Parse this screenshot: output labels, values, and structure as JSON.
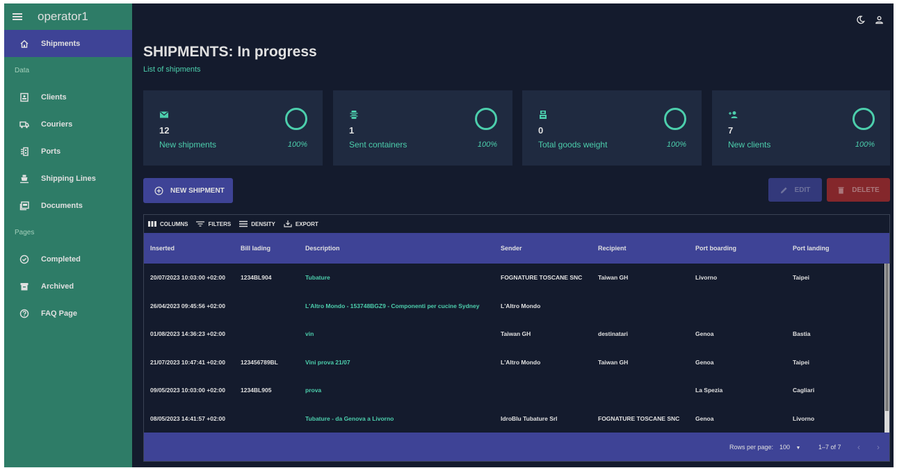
{
  "sidebar": {
    "user": "operator1",
    "items": [
      {
        "label": "Shipments"
      },
      {
        "label": "Clients"
      },
      {
        "label": "Couriers"
      },
      {
        "label": "Ports"
      },
      {
        "label": "Shipping Lines"
      },
      {
        "label": "Documents"
      },
      {
        "label": "Completed"
      },
      {
        "label": "Archived"
      },
      {
        "label": "FAQ Page"
      }
    ],
    "sections": [
      "Data",
      "Pages"
    ]
  },
  "header": {
    "title": "SHIPMENTS: In progress",
    "subtitle": "List of shipments"
  },
  "stats": [
    {
      "value": "12",
      "label": "New shipments",
      "percent": "100%",
      "icon": "mail-icon"
    },
    {
      "value": "1",
      "label": "Sent containers",
      "percent": "100%",
      "icon": "container-icon"
    },
    {
      "value": "0",
      "label": "Total goods weight",
      "percent": "100%",
      "icon": "scale-icon"
    },
    {
      "value": "7",
      "label": "New clients",
      "percent": "100%",
      "icon": "person-add-icon"
    }
  ],
  "actions": {
    "new_label": "NEW SHIPMENT",
    "edit_label": "EDIT",
    "delete_label": "DELETE"
  },
  "toolbar": {
    "columns": "COLUMNS",
    "filters": "FILTERS",
    "density": "DENSITY",
    "export": "EXPORT"
  },
  "table": {
    "columns": [
      "Inserted",
      "Bill lading",
      "Description",
      "Sender",
      "Recipient",
      "Port boarding",
      "Port landing"
    ],
    "rows": [
      [
        "20/07/2023 10:03:00 +02:00",
        "1234BL904",
        "Tubature",
        "FOGNATURE TOSCANE SNC",
        "Taiwan GH",
        "Livorno",
        "Taipei"
      ],
      [
        "26/04/2023 09:45:56 +02:00",
        "",
        "L'Altro Mondo - 153748BGZ9 - Componenti per cucine Sydney",
        "L'Altro Mondo",
        "",
        "",
        ""
      ],
      [
        "01/08/2023 14:36:23 +02:00",
        "",
        "vin",
        "Taiwan GH",
        "destinatari",
        "Genoa",
        "Bastia"
      ],
      [
        "21/07/2023 10:47:41 +02:00",
        "123456789BL",
        "Vini prova 21/07",
        "L'Altro Mondo",
        "Taiwan GH",
        "Genoa",
        "Taipei"
      ],
      [
        "09/05/2023 10:03:00 +02:00",
        "1234BL905",
        "prova",
        "",
        "",
        "La Spezia",
        "Cagliari"
      ],
      [
        "08/05/2023 14:41:57 +02:00",
        "",
        "Tubature - da Genova a Livorno",
        "IdroBlu Tubature Srl",
        "FOGNATURE TOSCANE SNC",
        "Genoa",
        "Livorno"
      ]
    ],
    "footer": {
      "rows_per_page_label": "Rows per page:",
      "rows_per_page": "100",
      "range": "1–7 of 7"
    }
  },
  "colors": {
    "sidebar": "#2e7c67",
    "accent": "#4cceac",
    "primary": "#3e4396",
    "background": "#141b2d",
    "card": "#1f2a40",
    "danger": "#a02b2b"
  }
}
